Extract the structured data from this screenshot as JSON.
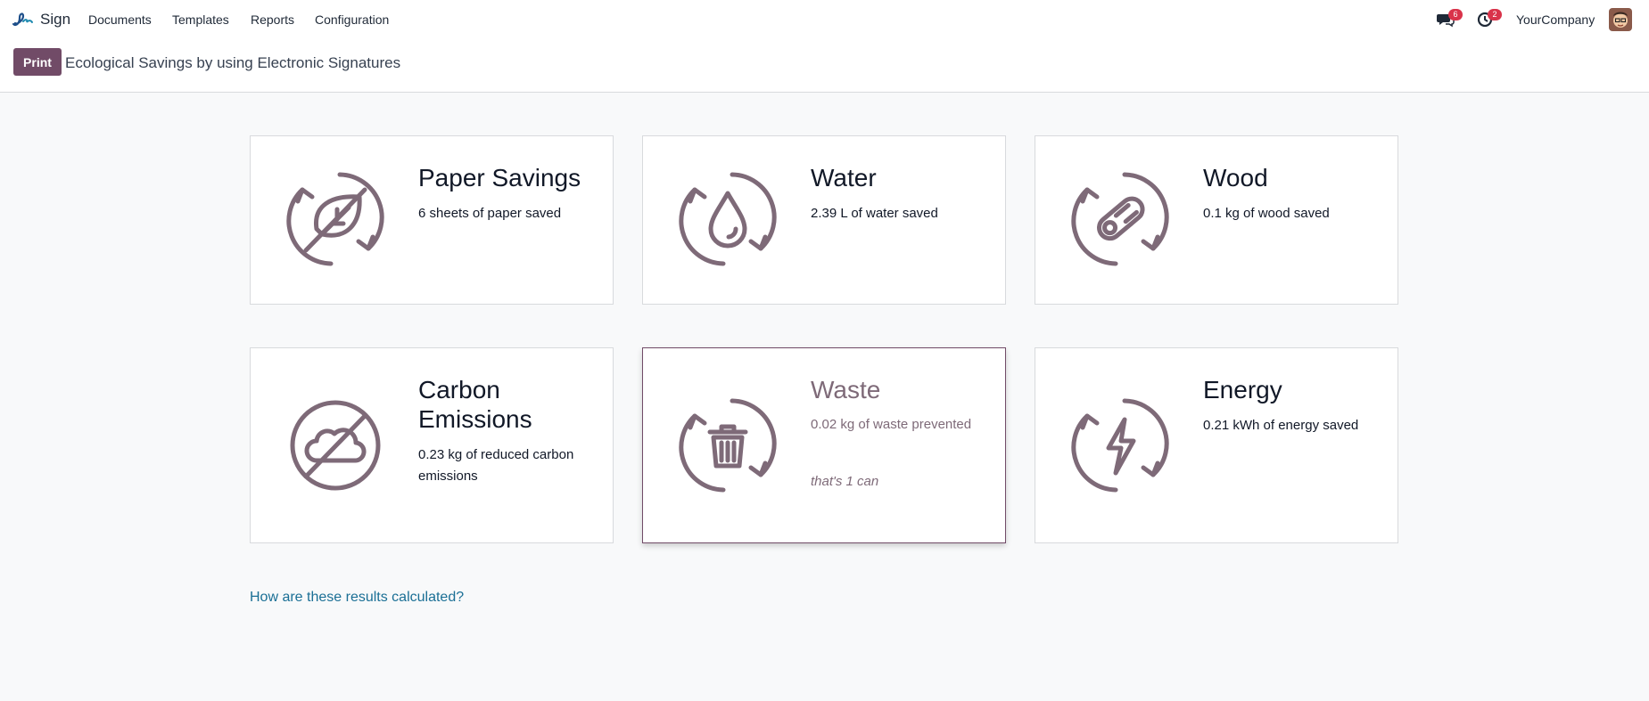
{
  "nav": {
    "app_name": "Sign",
    "menu": [
      "Documents",
      "Templates",
      "Reports",
      "Configuration"
    ],
    "messages_badge": "6",
    "activity_badge": "2",
    "company": "YourCompany"
  },
  "control": {
    "print_label": "Print",
    "title": "Ecological Savings by using Electronic Signatures"
  },
  "cards": [
    {
      "title": "Paper Savings",
      "desc": "6 sheets of paper saved",
      "icon": "leaf-recycle-icon"
    },
    {
      "title": "Water",
      "desc": "2.39 L of water saved",
      "icon": "water-drop-recycle-icon"
    },
    {
      "title": "Wood",
      "desc": "0.1 kg of wood saved",
      "icon": "wood-log-recycle-icon"
    },
    {
      "title": "Carbon Emissions",
      "desc": "0.23 kg of reduced carbon emissions",
      "icon": "cloud-crossed-icon"
    },
    {
      "title": "Waste",
      "desc": "0.02 kg of waste prevented",
      "note": "that's 1 can",
      "icon": "trash-recycle-icon"
    },
    {
      "title": "Energy",
      "desc": "0.21 kWh of energy saved",
      "icon": "lightning-recycle-icon"
    }
  ],
  "help_link": "How are these results calculated?",
  "colors": {
    "brand": "#714b67",
    "icon": "#7e6a78",
    "link": "#1a6f95",
    "badge": "#d9334a"
  }
}
